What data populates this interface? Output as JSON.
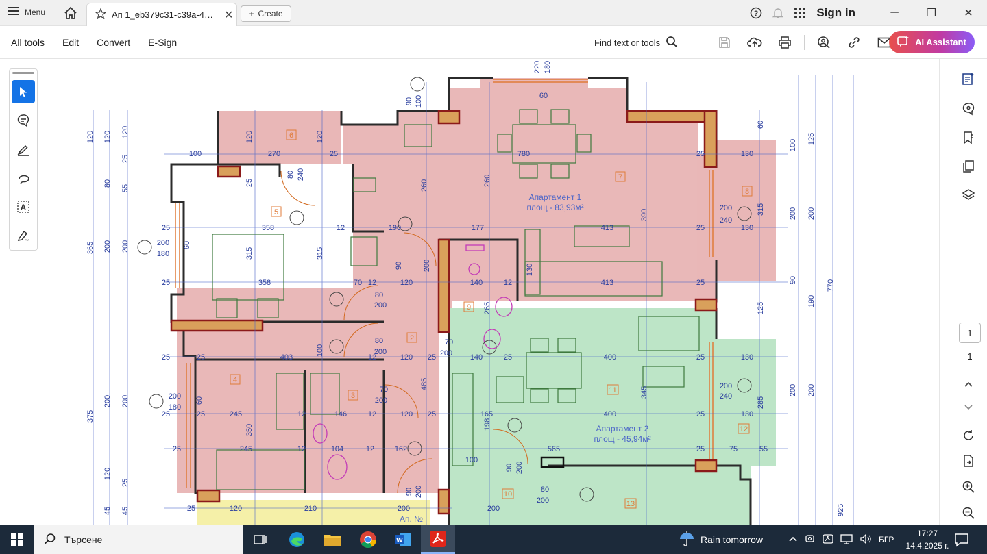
{
  "titlebar": {
    "menu_label": "Menu",
    "tab_title": "Ап 1_eb379c31-c39a-48...",
    "create_label": "Create",
    "sign_in": "Sign in"
  },
  "toolbar": {
    "all_tools": "All tools",
    "edit": "Edit",
    "convert": "Convert",
    "esign": "E-Sign",
    "find": "Find text or tools",
    "ai_assistant": "AI Assistant"
  },
  "page_nav": {
    "current": "1",
    "total": "1"
  },
  "plan": {
    "apt1_name": "Апартамент 1",
    "apt1_area": "площ - 83,93м²",
    "apt2_name": "Апартамент 2",
    "apt2_area": "площ - 45,94м²",
    "apt_no": "Ап. №",
    "rooms": [
      "2",
      "3",
      "4",
      "5",
      "6",
      "7",
      "8",
      "9",
      "10",
      "11",
      "12",
      "13"
    ],
    "top_dims": [
      "220",
      "180",
      "60"
    ]
  },
  "taskbar": {
    "search_placeholder": "Търсене",
    "weather": "Rain tomorrow",
    "language": "БГР",
    "time": "17:27",
    "date": "14.4.2025 г."
  },
  "colors": {
    "apt1_fill": "#e8b4b4",
    "apt2_fill": "#b9e4c4",
    "wall_red": "#a52a2a",
    "dim_blue": "#4a64c8",
    "accent": "#1473e6"
  }
}
